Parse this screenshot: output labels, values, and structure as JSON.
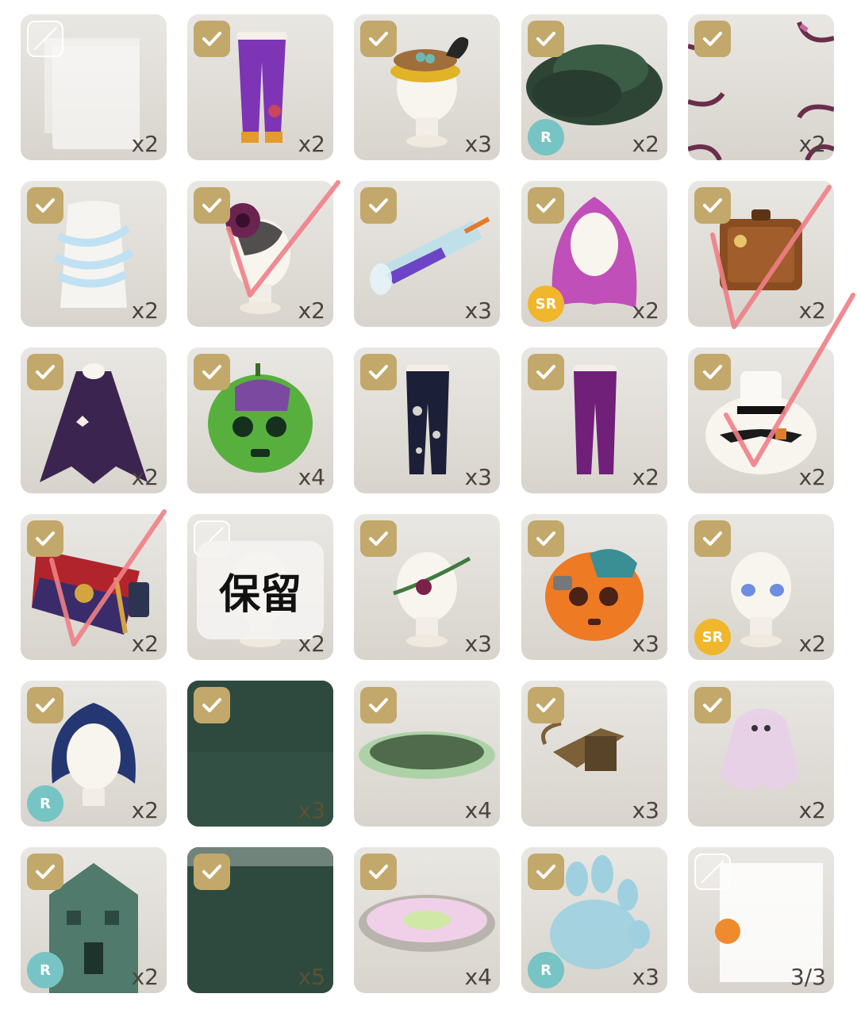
{
  "items": [
    {
      "row": 0,
      "col": 0,
      "count": "x2",
      "selected": false,
      "rarity": "",
      "art": "skeleton-costume",
      "label": ""
    },
    {
      "row": 0,
      "col": 1,
      "count": "x2",
      "selected": true,
      "rarity": "",
      "art": "purple-pants",
      "label": ""
    },
    {
      "row": 0,
      "col": 2,
      "count": "x3",
      "selected": true,
      "rarity": "",
      "art": "nest-crow-hat",
      "label": ""
    },
    {
      "row": 0,
      "col": 3,
      "count": "x2",
      "selected": true,
      "rarity": "R",
      "art": "dark-bush",
      "label": ""
    },
    {
      "row": 0,
      "col": 4,
      "count": "x2",
      "selected": true,
      "rarity": "",
      "art": "branch-frame",
      "label": ""
    },
    {
      "row": 1,
      "col": 0,
      "count": "x2",
      "selected": true,
      "rarity": "",
      "art": "bandage-top",
      "label": ""
    },
    {
      "row": 1,
      "col": 1,
      "count": "x2",
      "selected": true,
      "rarity": "",
      "art": "rose-web-headpiece",
      "label": ""
    },
    {
      "row": 1,
      "col": 2,
      "count": "x3",
      "selected": true,
      "rarity": "",
      "art": "potion-glass",
      "label": ""
    },
    {
      "row": 1,
      "col": 3,
      "count": "x2",
      "selected": true,
      "rarity": "SR",
      "art": "pink-hair",
      "label": ""
    },
    {
      "row": 1,
      "col": 4,
      "count": "x2",
      "selected": true,
      "rarity": "",
      "art": "suitcase",
      "label": ""
    },
    {
      "row": 2,
      "col": 0,
      "count": "x2",
      "selected": true,
      "rarity": "",
      "art": "bat-cape",
      "label": ""
    },
    {
      "row": 2,
      "col": 1,
      "count": "x4",
      "selected": true,
      "rarity": "",
      "art": "green-pumpkin-head",
      "label": ""
    },
    {
      "row": 2,
      "col": 2,
      "count": "x3",
      "selected": true,
      "rarity": "",
      "art": "torn-leggings",
      "label": ""
    },
    {
      "row": 2,
      "col": 3,
      "count": "x2",
      "selected": true,
      "rarity": "",
      "art": "purple-tights",
      "label": ""
    },
    {
      "row": 2,
      "col": 4,
      "count": "x2",
      "selected": true,
      "rarity": "",
      "art": "top-hat",
      "label": ""
    },
    {
      "row": 3,
      "col": 0,
      "count": "x2",
      "selected": true,
      "rarity": "",
      "art": "letter-key",
      "label": ""
    },
    {
      "row": 3,
      "col": 1,
      "count": "x2",
      "selected": false,
      "rarity": "",
      "art": "head-bust",
      "label": "保留"
    },
    {
      "row": 3,
      "col": 2,
      "count": "x3",
      "selected": true,
      "rarity": "",
      "art": "vine-headband",
      "label": ""
    },
    {
      "row": 3,
      "col": 3,
      "count": "x3",
      "selected": true,
      "rarity": "",
      "art": "orange-pumpkin-head",
      "label": ""
    },
    {
      "row": 3,
      "col": 4,
      "count": "x2",
      "selected": true,
      "rarity": "SR",
      "art": "blue-eyes",
      "label": ""
    },
    {
      "row": 4,
      "col": 0,
      "count": "x2",
      "selected": true,
      "rarity": "R",
      "art": "navy-hair",
      "label": ""
    },
    {
      "row": 4,
      "col": 1,
      "count": "x3",
      "selected": true,
      "rarity": "",
      "art": "green-background",
      "label": ""
    },
    {
      "row": 4,
      "col": 2,
      "count": "x4",
      "selected": true,
      "rarity": "",
      "art": "green-floor-ring",
      "label": ""
    },
    {
      "row": 4,
      "col": 3,
      "count": "x3",
      "selected": true,
      "rarity": "",
      "art": "lantern",
      "label": ""
    },
    {
      "row": 4,
      "col": 4,
      "count": "x2",
      "selected": true,
      "rarity": "",
      "art": "ghost-pet",
      "label": ""
    },
    {
      "row": 5,
      "col": 0,
      "count": "x2",
      "selected": true,
      "rarity": "R",
      "art": "haunted-house",
      "label": ""
    },
    {
      "row": 5,
      "col": 1,
      "count": "x5",
      "selected": true,
      "rarity": "",
      "art": "green-background-2",
      "label": ""
    },
    {
      "row": 5,
      "col": 2,
      "count": "x4",
      "selected": true,
      "rarity": "",
      "art": "mosaic-floor",
      "label": ""
    },
    {
      "row": 5,
      "col": 3,
      "count": "x3",
      "selected": true,
      "rarity": "R",
      "art": "ghost-hand",
      "label": ""
    },
    {
      "row": 5,
      "col": 4,
      "count": "3/3",
      "selected": false,
      "rarity": "",
      "art": "hidden-item",
      "label": ""
    }
  ],
  "colors": {
    "tile_bg": "#dcd8d1",
    "check_gold": "#c2a86a",
    "rarity_r": "#77c4c4",
    "rarity_sr": "#f0b62c",
    "pink_mark": "#ef7f86"
  }
}
